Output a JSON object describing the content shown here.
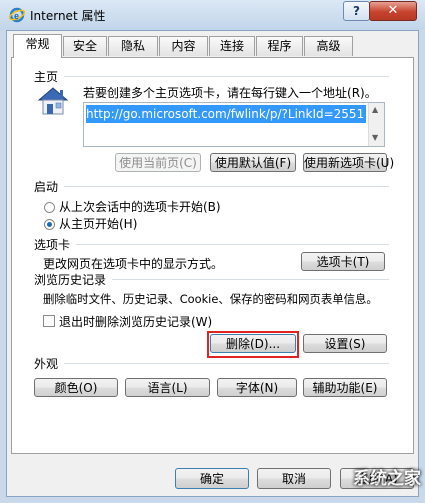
{
  "window": {
    "title": "Internet 属性",
    "help": "?",
    "close": "✕"
  },
  "tabs": [
    "常规",
    "安全",
    "隐私",
    "内容",
    "连接",
    "程序",
    "高级"
  ],
  "home": {
    "title": "主页",
    "desc": "若要创建多个主页选项卡，请在每行键入一个地址",
    "desc_key": "(R)。",
    "url": "http://go.microsoft.com/fwlink/p/?LinkId=2551",
    "buttons": [
      "使用当前页(C)",
      "使用默认值(F)",
      "使用新选项卡(U)"
    ]
  },
  "startup": {
    "title": "启动",
    "options": [
      "从上次会话中的选项卡开始(B)",
      "从主页开始(H)"
    ],
    "selected": 1
  },
  "tabs_section": {
    "title": "选项卡",
    "desc": "更改网页在选项卡中的显示方式。",
    "button": "选项卡(T)"
  },
  "history": {
    "title": "浏览历史记录",
    "desc": "删除临时文件、历史记录、Cookie、保存的密码和网页表单信息。",
    "checkbox": "退出时删除浏览历史记录(W)",
    "checked": false,
    "delete_button": "删除(D)...",
    "settings_button": "设置(S)"
  },
  "appearance": {
    "title": "外观",
    "buttons": [
      "颜色(O)",
      "语言(L)",
      "字体(N)",
      "辅助功能(E)"
    ]
  },
  "footer": {
    "ok": "确定",
    "cancel": "取消",
    "apply": "应用(A)"
  },
  "watermark": "系统之家",
  "colors": {
    "highlight": "#e02323",
    "selection": "#3399ff"
  }
}
